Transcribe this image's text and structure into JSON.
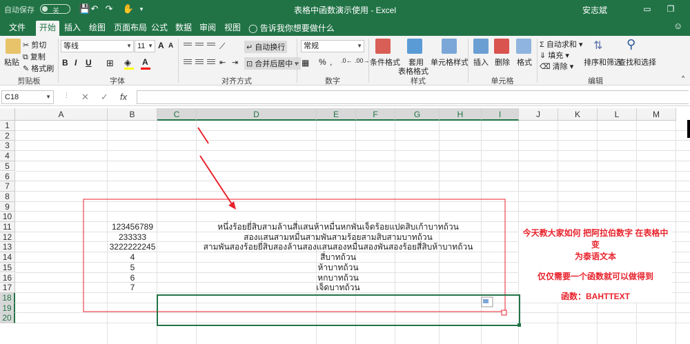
{
  "titlebar": {
    "autosave_label": "自动保存",
    "autosave_state": "关",
    "doc_title": "表格中函数演示使用  -  Excel",
    "user": "安志斌"
  },
  "tabs": [
    {
      "label": "文件"
    },
    {
      "label": "开始"
    },
    {
      "label": "插入"
    },
    {
      "label": "绘图"
    },
    {
      "label": "页面布局"
    },
    {
      "label": "公式"
    },
    {
      "label": "数据"
    },
    {
      "label": "审阅"
    },
    {
      "label": "视图"
    }
  ],
  "tell_me": "告诉我你想要做什么",
  "ribbon": {
    "clipboard": {
      "paste": "粘贴",
      "cut": "剪切",
      "copy": "复制",
      "format_painter": "格式刷",
      "label": "剪贴板"
    },
    "font": {
      "name": "等线",
      "size": "11",
      "grow": "A",
      "shrink": "A",
      "label": "字体"
    },
    "alignment": {
      "wrap": "自动换行",
      "merge": "合并后居中",
      "label": "对齐方式"
    },
    "number": {
      "format": "常规",
      "label": "数字"
    },
    "styles": {
      "conditional": "条件格式",
      "table_l1": "套用",
      "table_l2": "表格格式",
      "cell_styles": "单元格样式",
      "label": "样式"
    },
    "cells": {
      "insert": "插入",
      "delete": "删除",
      "format": "格式",
      "label": "单元格"
    },
    "editing": {
      "autosum": "自动求和",
      "fill": "填充",
      "clear": "清除",
      "sort_l1": "排序和筛选",
      "find_l1": "查找和选择",
      "label": "编辑"
    }
  },
  "formula_bar": {
    "name_box": "C18",
    "cancel": "✕",
    "enter": "✓",
    "fx": "fx",
    "value": ""
  },
  "columns": [
    "A",
    "B",
    "C",
    "D",
    "E",
    "F",
    "G",
    "H",
    "I",
    "J",
    "K",
    "L",
    "M"
  ],
  "rows": [
    "1",
    "2",
    "3",
    "4",
    "5",
    "6",
    "7",
    "8",
    "9",
    "10",
    "11",
    "12",
    "13",
    "14",
    "15",
    "16",
    "17",
    "18",
    "19",
    "20"
  ],
  "cells": {
    "B11": "123456789",
    "B12": "233333",
    "B13": "3222222245",
    "B14": "4",
    "B15": "5",
    "B16": "6",
    "B17": "7",
    "D11": "หนึ่งร้อยยี่สิบสามล้านสี่แสนห้าหมื่นหกพันเจ็ดร้อยแปดสิบเก้าบาทถ้วน",
    "D12": "สองแสนสามหมื่นสามพันสามร้อยสามสิบสามบาทถ้วน",
    "D13": "สามพันสองร้อยยี่สิบสองล้านสองแสนสองหมื่นสองพันสองร้อยสี่สิบห้าบาทถ้วน",
    "D14": "สี่บาทถ้วน",
    "D15": "ห้าบาทถ้วน",
    "D16": "หกบาทถ้วน",
    "D17": "เจ็ดบาทถ้วน"
  },
  "note": {
    "line1": "今天教大家如何 把阿拉伯数字 在表格中变",
    "line2": "为泰语文本",
    "line3": "仅仅需要一个函数就可以做得到",
    "line4": "函数：BAHTTEXT"
  },
  "colors": {
    "excel_green": "#217346",
    "annotation_red": "#e8222c",
    "selection": "#217346"
  }
}
